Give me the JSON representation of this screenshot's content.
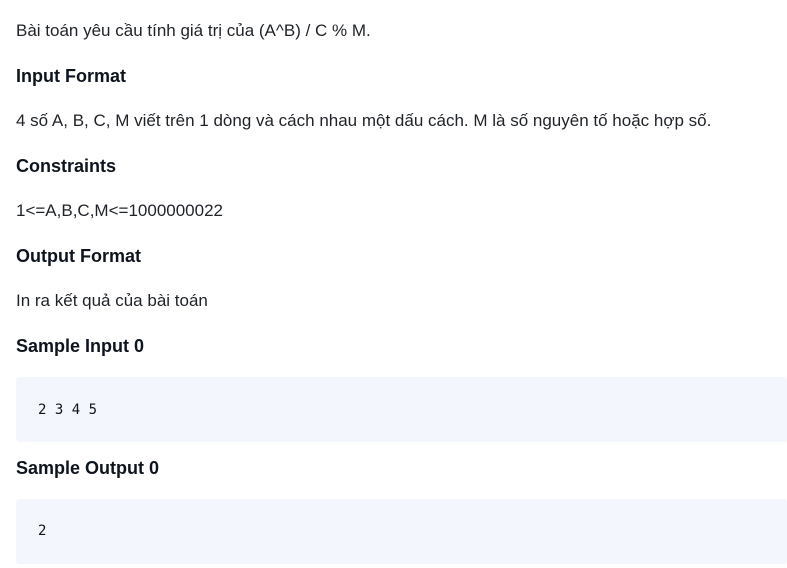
{
  "problem": {
    "statement": "Bài toán yêu cầu tính giá trị của (A^B) / C % M.",
    "input_format_heading": "Input Format",
    "input_format": "4 số A, B, C, M viết trên 1 dòng và cách nhau một dấu cách. M là số nguyên tố hoặc hợp số.",
    "constraints_heading": "Constraints",
    "constraints": "1<=A,B,C,M<=1000000022",
    "output_format_heading": "Output Format",
    "output_format": "In ra kết quả của bài toán",
    "sample_input_heading": "Sample Input 0",
    "sample_input": "2 3 4 5",
    "sample_output_heading": "Sample Output 0",
    "sample_output": "2"
  }
}
